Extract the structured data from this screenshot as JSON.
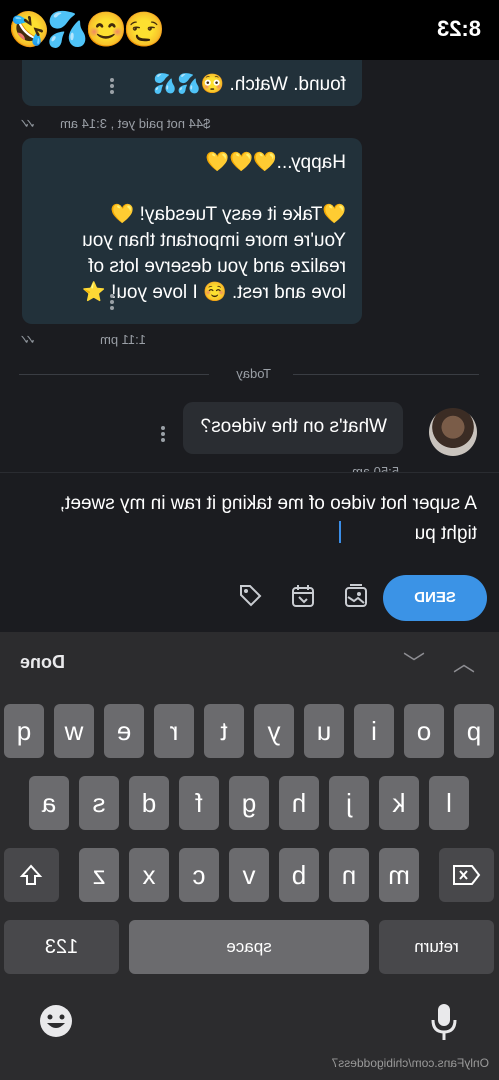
{
  "status_bar": {
    "time": "8:23",
    "emojis": "😏😊💦🤣"
  },
  "messages": [
    {
      "text_lines": [
        "found. Watch. 😳💦💦"
      ],
      "meta": "$44 not paid yet , 3:14 am"
    },
    {
      "text_lines": [
        "Happy...💛💛💛",
        "",
        "💛Take it easy Tuesday! 💛",
        "You're more important than you",
        "realize and you deserve lots of",
        "love and rest. ☺️ I love you! ⭐"
      ],
      "meta": "1:11 pm"
    },
    {
      "text": "What's on the videos?",
      "meta": "5:50 am"
    }
  ],
  "day_divider": "Today",
  "composer": {
    "draft_text": "A super hot video of me taking it raw in my sweet, tight pu",
    "send_label": "SEND",
    "tools": [
      "image-icon",
      "mic-icon",
      "gallery-icon",
      "calendar-icon",
      "price-tag-icon"
    ]
  },
  "keyboard": {
    "done_label": "Done",
    "row1": [
      "q",
      "w",
      "e",
      "r",
      "t",
      "y",
      "u",
      "i",
      "o",
      "p"
    ],
    "row2": [
      "a",
      "s",
      "d",
      "f",
      "g",
      "h",
      "j",
      "k",
      "l"
    ],
    "row3": [
      "z",
      "x",
      "c",
      "v",
      "b",
      "n",
      "m"
    ],
    "numbers_label": "123",
    "space_label": "space",
    "return_label": "return"
  },
  "watermark": "OnlyFans.com/chibigoddess7"
}
